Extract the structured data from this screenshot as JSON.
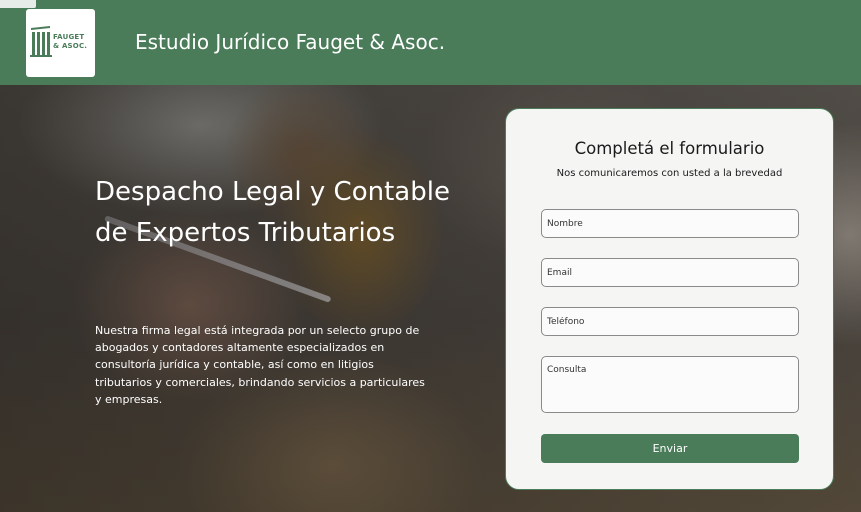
{
  "header": {
    "logo_text_line1": "FAUGET",
    "logo_text_line2": "& ASOC.",
    "site_title": "Estudio Jurídico Fauget & Asoc."
  },
  "hero": {
    "heading": "Despacho Legal y Contable de Expertos Tributarios",
    "description": "Nuestra firma legal está integrada por un selecto grupo de abogados y contadores altamente especializados en consultoría jurídica y contable, así como en litigios tributarios y comerciales, brindando servicios a particulares y empresas."
  },
  "form": {
    "title": "Completá el formulario",
    "subtitle": "Nos comunicaremos con usted a la brevedad",
    "fields": {
      "name_placeholder": "Nombre",
      "email_placeholder": "Email",
      "phone_placeholder": "Teléfono",
      "query_placeholder": "Consulta"
    },
    "submit_label": "Enviar"
  },
  "colors": {
    "brand_green": "#4a7c59",
    "card_background": "#f5f5f4",
    "text_light": "#ffffff"
  },
  "icons": {
    "logo": "columns-logo-icon"
  }
}
